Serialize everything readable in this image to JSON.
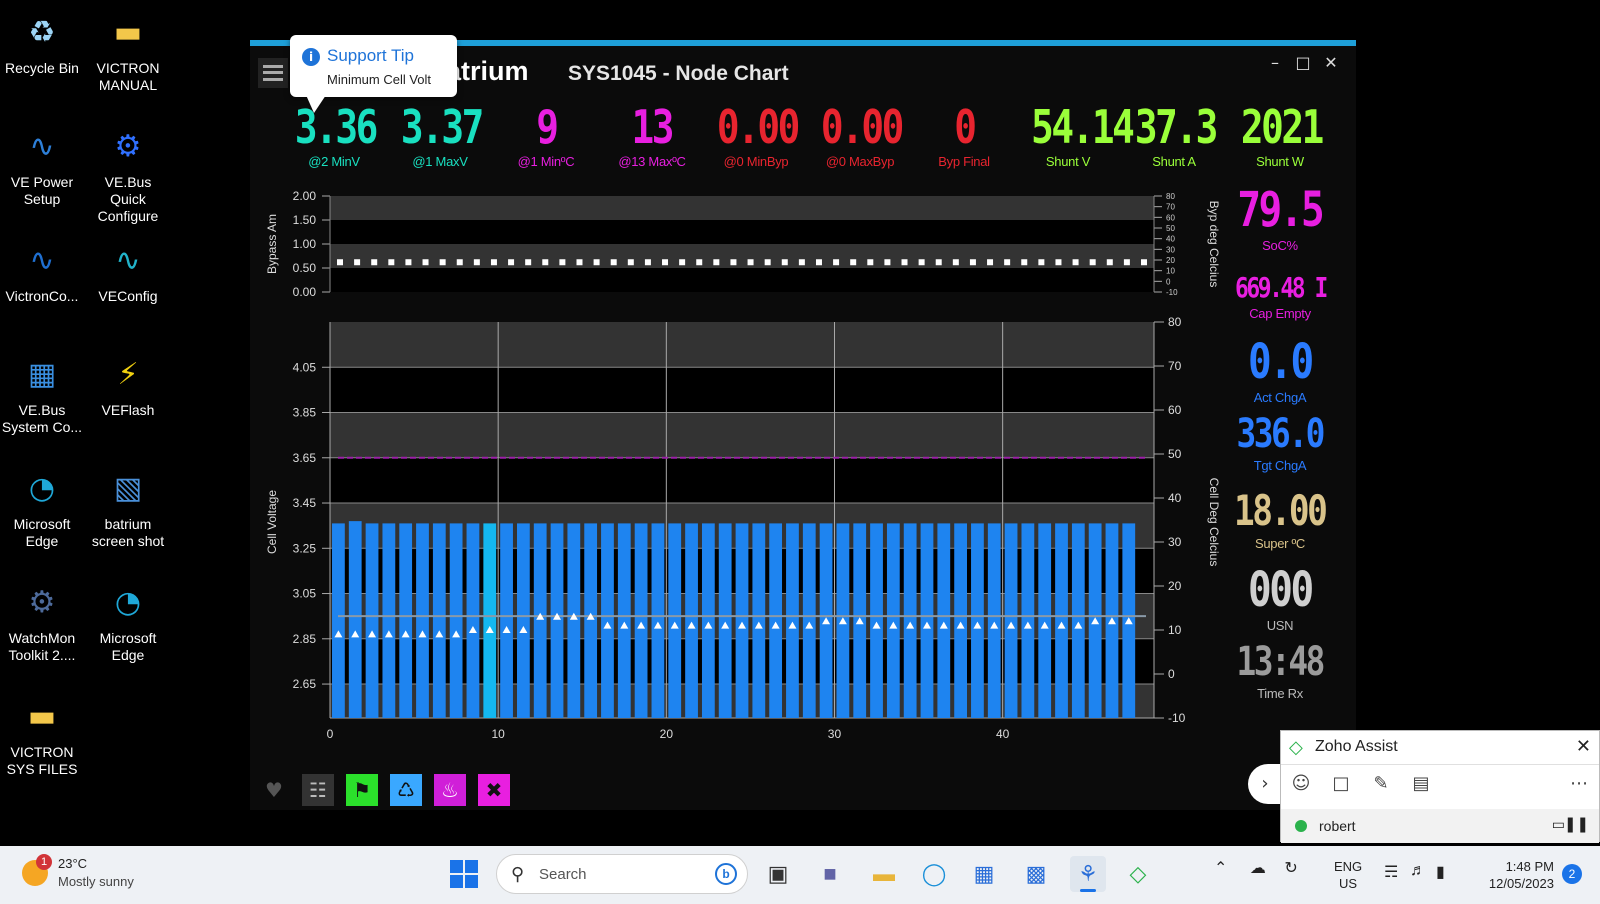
{
  "desktop": {
    "icons": [
      {
        "label": "Recycle Bin",
        "icon": "recycle-bin-icon"
      },
      {
        "label": "VICTRON MANUAL",
        "icon": "folder-icon"
      },
      {
        "label": "VE Power Setup",
        "icon": "victron-icon"
      },
      {
        "label": "VE.Bus Quick Configure",
        "icon": "vebus-quick-icon"
      },
      {
        "label": "VictronCo...",
        "icon": "victron-connect-icon"
      },
      {
        "label": "VEConfig",
        "icon": "veconfig-icon"
      },
      {
        "label": "VE.Bus System Co...",
        "icon": "vebus-system-icon"
      },
      {
        "label": "VEFlash",
        "icon": "veflash-icon"
      },
      {
        "label": "Microsoft Edge",
        "icon": "edge-icon"
      },
      {
        "label": "batrium screen shot",
        "icon": "image-file-icon"
      },
      {
        "label": "WatchMon Toolkit 2....",
        "icon": "watchmon-icon"
      },
      {
        "label": "Microsoft Edge",
        "icon": "edge-icon"
      },
      {
        "label": "VICTRON SYS FILES",
        "icon": "folder-icon"
      }
    ]
  },
  "app": {
    "brand": "atrium",
    "title": "SYS1045 - Node Chart",
    "tooltip": {
      "title": "Support Tip",
      "subtitle": "Minimum Cell Volt"
    },
    "meters_top": [
      {
        "value": "3.36",
        "label": "@2 MinV",
        "color": "#19e0c0"
      },
      {
        "value": "3.37",
        "label": "@1 MaxV",
        "color": "#19e0c0"
      },
      {
        "value": "9",
        "label": "@1 MinºC",
        "color": "#e81fe0"
      },
      {
        "value": "13",
        "label": "@13 MaxºC",
        "color": "#e81fe0"
      },
      {
        "value": "0.00",
        "label": "@0 MinByp",
        "color": "#e8242f"
      },
      {
        "value": "0.00",
        "label": "@0 MaxByp",
        "color": "#e8242f"
      },
      {
        "value": "0",
        "label": "Byp Final",
        "color": "#e8242f"
      },
      {
        "value": "54.14",
        "label": "Shunt V",
        "color": "#9aff3a"
      },
      {
        "value": "37.3",
        "label": "Shunt A",
        "color": "#9aff3a"
      },
      {
        "value": "2021",
        "label": "Shunt W",
        "color": "#9aff3a"
      }
    ],
    "meters_side": [
      {
        "value": "79.5",
        "label": "SoC%",
        "color": "#e81fe0"
      },
      {
        "value": "669.48 I",
        "label": "Cap Empty",
        "color": "#e81fe0"
      },
      {
        "value": "0.0",
        "label": "Act ChgA",
        "color": "#2a7bff"
      },
      {
        "value": "336.0",
        "label": "Tgt ChgA",
        "color": "#2a7bff"
      },
      {
        "value": "18.00",
        "label": "Super ºC",
        "color": "#d9c38a"
      },
      {
        "value": "000",
        "label": "USN",
        "color": "#cfcfcf"
      },
      {
        "value": "13:48",
        "label": "Time Rx",
        "color": "#9b9b9b"
      }
    ],
    "toolbar": [
      "heart-icon",
      "signal-icon",
      "runner-icon",
      "charge-icon",
      "heater-icon",
      "fan-icon"
    ]
  },
  "chart_data": [
    {
      "type": "scatter",
      "name_hint": "bypass",
      "ylabel": "Bypass Am",
      "y2label": "Byp deg Celcius",
      "yticks": [
        "2.00",
        "1.50",
        "1.00",
        "0.50",
        "0.00"
      ],
      "y2ticks": [
        "80",
        "70",
        "60",
        "50",
        "40",
        "30",
        "20",
        "10",
        "0",
        "-10"
      ],
      "ylim": [
        0,
        2
      ],
      "y2lim": [
        -10,
        80
      ],
      "x": [
        0,
        1,
        2,
        3,
        4,
        5,
        6,
        7,
        8,
        9,
        10,
        11,
        12,
        13,
        14,
        15,
        16,
        17,
        18,
        19,
        20,
        21,
        22,
        23,
        24,
        25,
        26,
        27,
        28,
        29,
        30,
        31,
        32,
        33,
        34,
        35,
        36,
        37,
        38,
        39,
        40,
        41,
        42,
        43,
        44,
        45,
        46,
        47
      ],
      "values": [
        0.62,
        0.62,
        0.62,
        0.62,
        0.62,
        0.62,
        0.62,
        0.62,
        0.62,
        0.62,
        0.62,
        0.62,
        0.62,
        0.62,
        0.62,
        0.62,
        0.62,
        0.62,
        0.62,
        0.62,
        0.62,
        0.62,
        0.62,
        0.62,
        0.62,
        0.62,
        0.62,
        0.62,
        0.62,
        0.62,
        0.62,
        0.62,
        0.62,
        0.62,
        0.62,
        0.62,
        0.62,
        0.62,
        0.62,
        0.62,
        0.62,
        0.62,
        0.62,
        0.62,
        0.62,
        0.62,
        0.62,
        0.62
      ]
    },
    {
      "type": "bar",
      "ylabel": "Cell Voltage",
      "y2label": "Cell Deg Celcius",
      "yticks": [
        "4.05",
        "3.85",
        "3.65",
        "3.45",
        "3.25",
        "3.05",
        "2.85",
        "2.65"
      ],
      "y2ticks": [
        "80",
        "70",
        "60",
        "50",
        "40",
        "30",
        "20",
        "10",
        "0",
        "-10"
      ],
      "xticks": [
        "0",
        "10",
        "20",
        "30",
        "40"
      ],
      "ylim": [
        2.5,
        4.25
      ],
      "y2lim": [
        -10,
        80
      ],
      "x": [
        0,
        1,
        2,
        3,
        4,
        5,
        6,
        7,
        8,
        9,
        10,
        11,
        12,
        13,
        14,
        15,
        16,
        17,
        18,
        19,
        20,
        21,
        22,
        23,
        24,
        25,
        26,
        27,
        28,
        29,
        30,
        31,
        32,
        33,
        34,
        35,
        36,
        37,
        38,
        39,
        40,
        41,
        42,
        43,
        44,
        45,
        46,
        47
      ],
      "highlight_index": 9,
      "series": [
        {
          "values": [
            3.36,
            3.37,
            3.36,
            3.36,
            3.36,
            3.36,
            3.36,
            3.36,
            3.36,
            3.36,
            3.36,
            3.36,
            3.36,
            3.36,
            3.36,
            3.36,
            3.36,
            3.36,
            3.36,
            3.36,
            3.36,
            3.36,
            3.36,
            3.36,
            3.36,
            3.36,
            3.36,
            3.36,
            3.36,
            3.36,
            3.36,
            3.36,
            3.36,
            3.36,
            3.36,
            3.36,
            3.36,
            3.36,
            3.36,
            3.36,
            3.36,
            3.36,
            3.36,
            3.36,
            3.36,
            3.36,
            3.36,
            3.36
          ]
        },
        {
          "values": [
            9,
            9,
            9,
            9,
            9,
            9,
            9,
            9,
            10,
            10,
            10,
            10,
            13,
            13,
            13,
            13,
            11,
            11,
            11,
            11,
            11,
            11,
            11,
            11,
            11,
            11,
            11,
            11,
            11,
            12,
            12,
            12,
            11,
            11,
            11,
            11,
            11,
            11,
            11,
            11,
            11,
            11,
            11,
            11,
            11,
            12,
            12,
            12
          ]
        }
      ],
      "max_limit_v": 3.65,
      "min_limit_v": 2.95
    }
  ],
  "zoho": {
    "title": "Zoho Assist",
    "user": "robert"
  },
  "taskbar": {
    "temp": "23°C",
    "weather": "Mostly sunny",
    "weather_badge": "1",
    "search_placeholder": "Search",
    "lang1": "ENG",
    "lang2": "US",
    "time": "1:48 PM",
    "date": "12/05/2023",
    "notif": "2"
  }
}
